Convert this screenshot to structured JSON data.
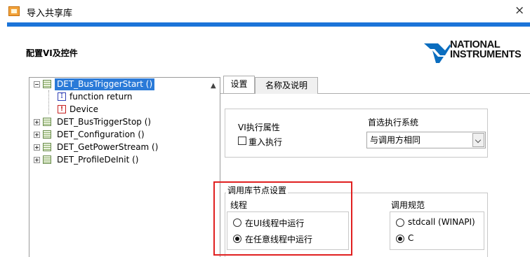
{
  "window": {
    "title": "导入共享库",
    "close_glyph": "×"
  },
  "page": {
    "section_title": "配置VI及控件"
  },
  "logo": {
    "line1": "NATIONAL",
    "line2": "INSTRUMENTS",
    "color": "#0a6dbf"
  },
  "accent_color": "#1b74d9",
  "tree": {
    "items": [
      {
        "label": "DET_BusTriggerStart ()",
        "expanded": true,
        "selected": true
      },
      {
        "label": "function return",
        "icon": "I"
      },
      {
        "label": "Device",
        "icon": "!"
      },
      {
        "label": "DET_BusTriggerStop ()"
      },
      {
        "label": "DET_Configuration ()"
      },
      {
        "label": "DET_GetPowerStream ()"
      },
      {
        "label": "DET_ProfileDeInit ()"
      }
    ]
  },
  "tabs": [
    {
      "label": "设置",
      "active": true
    },
    {
      "label": "名称及说明",
      "active": false
    }
  ],
  "settings": {
    "vi_exec_label": "VI执行属性",
    "reentrant_label": "重入执行",
    "reentrant_checked": false,
    "pref_exec_label": "首选执行系统",
    "pref_exec_value": "与调用方相同",
    "call_node_group": "调用库节点设置",
    "thread_label": "线程",
    "thread_options": [
      "在UI线程中运行",
      "在任意线程中运行"
    ],
    "thread_selected": 1,
    "calling_conv_label": "调用规范",
    "calling_conv_options": [
      "stdcall (WINAPI)",
      "C"
    ],
    "calling_conv_selected": 1
  },
  "highlight_color": "#e02020"
}
